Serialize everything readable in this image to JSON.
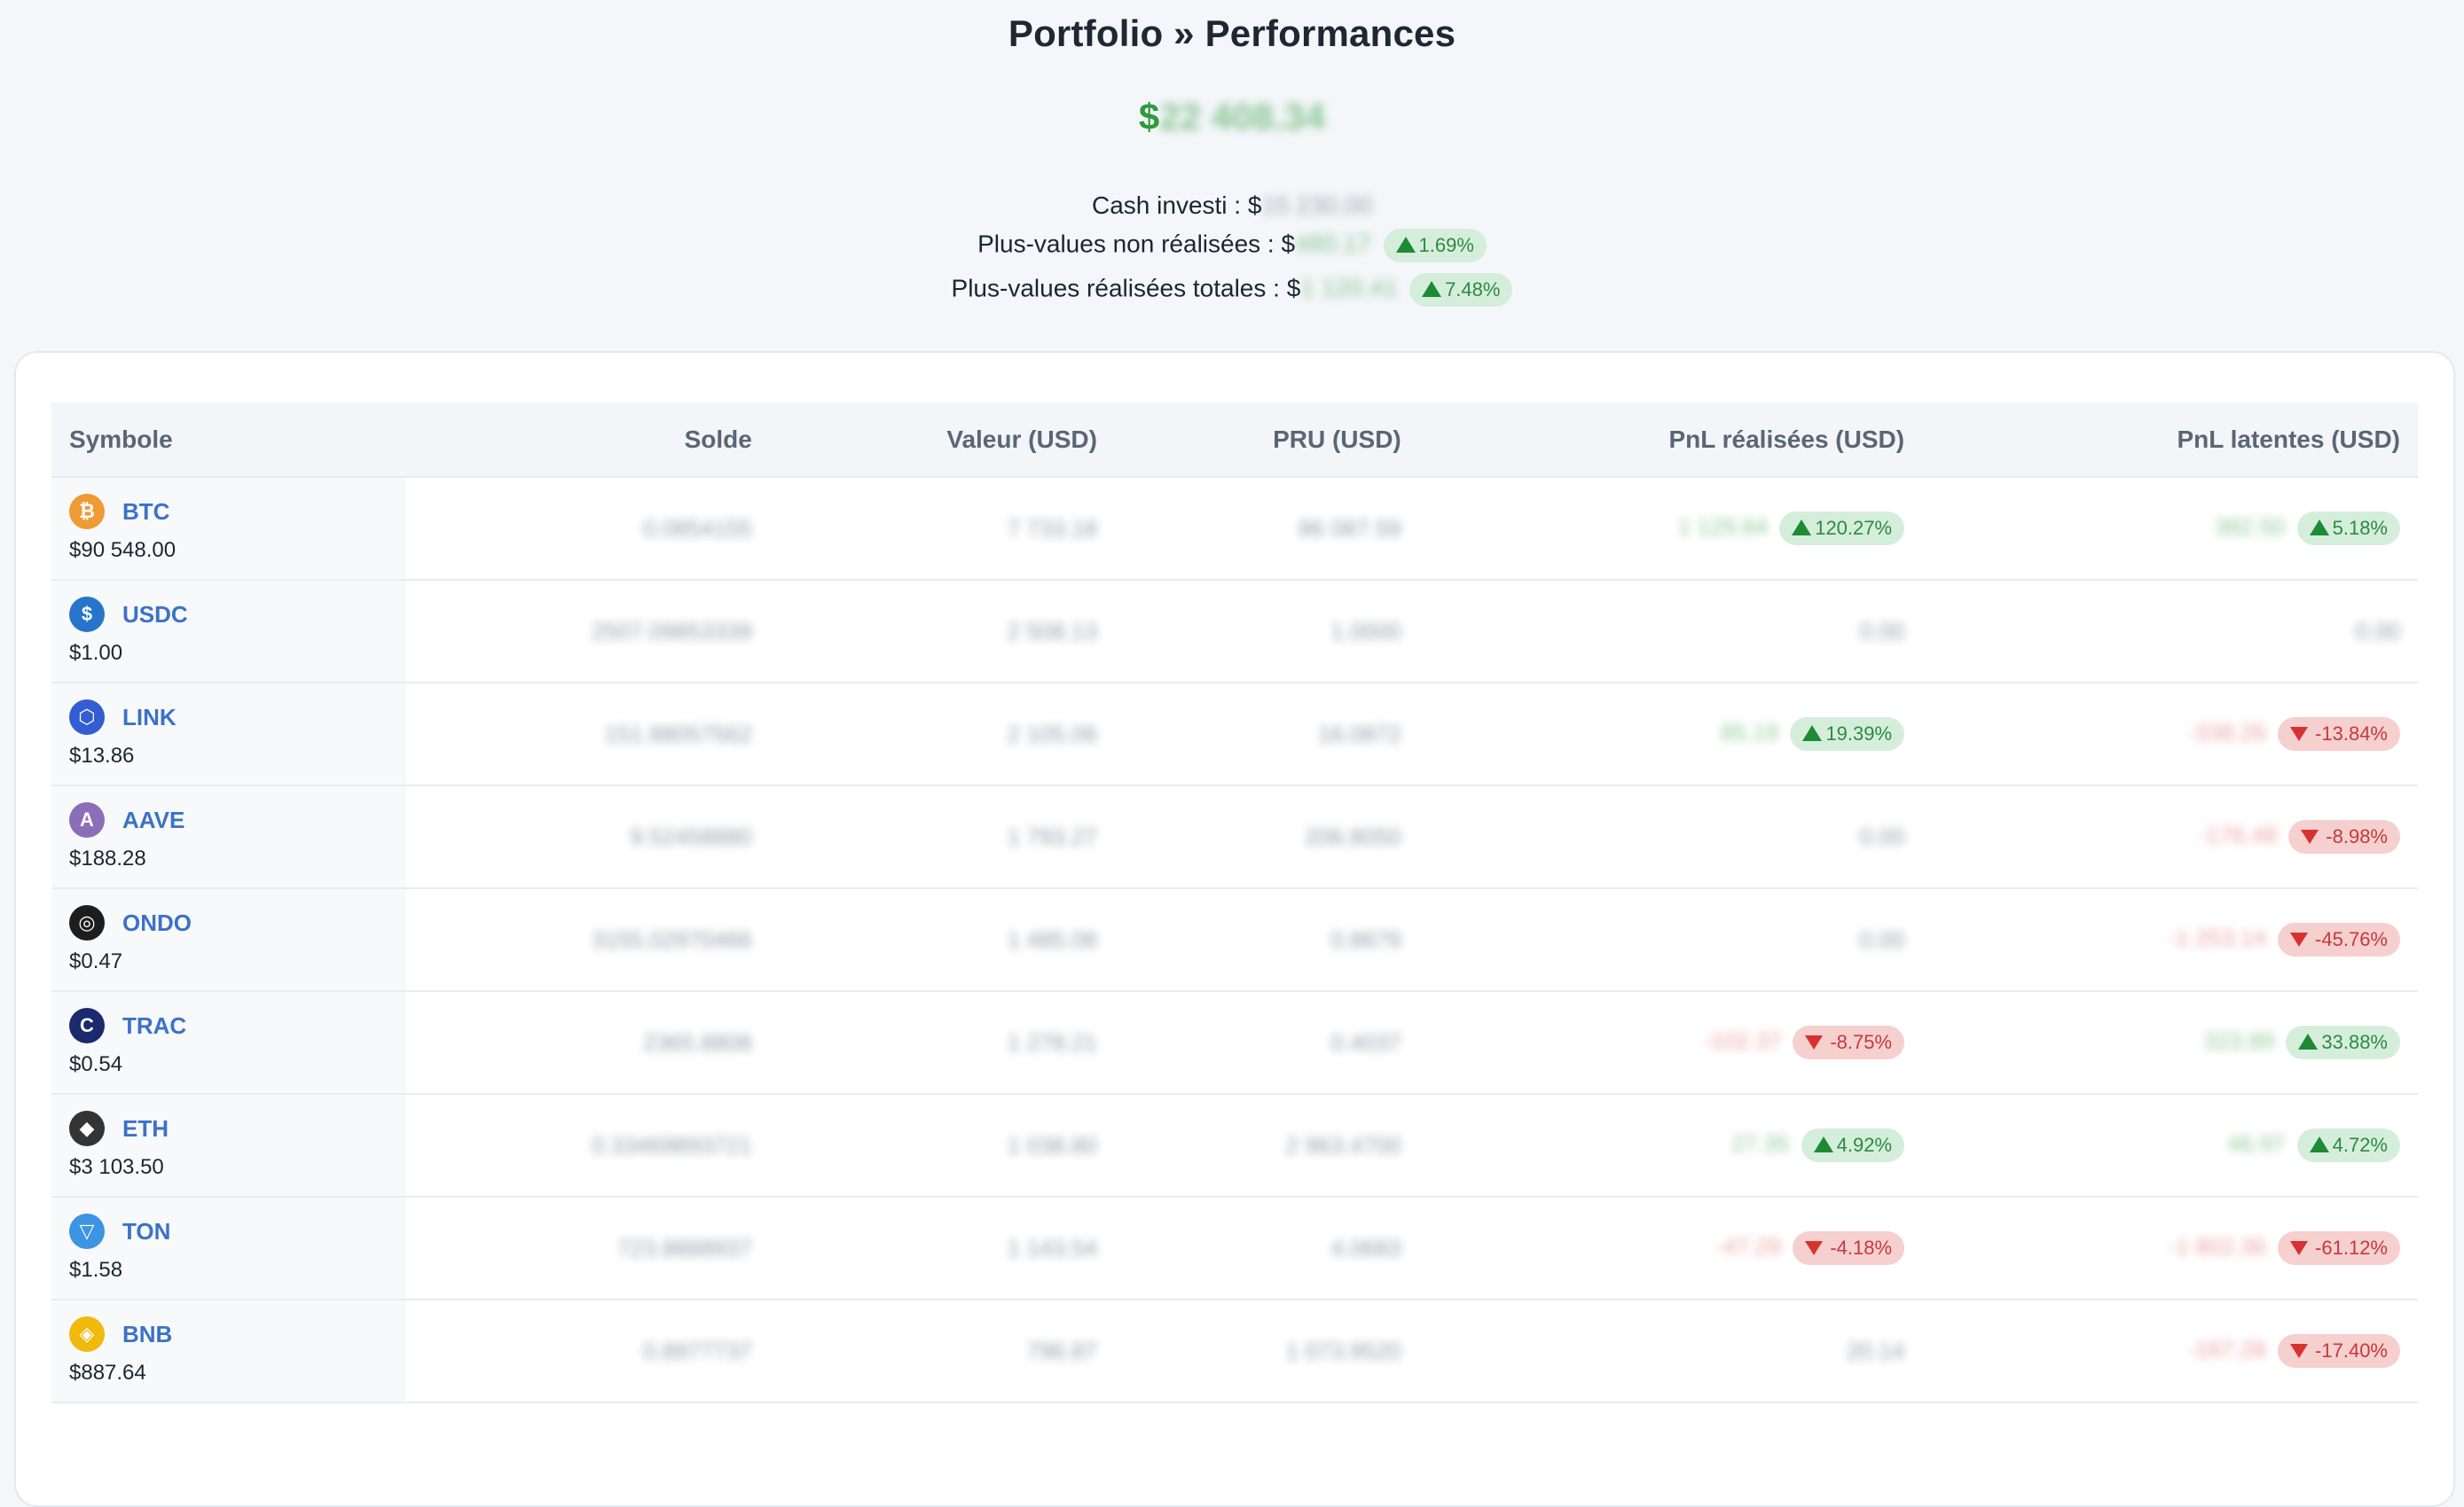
{
  "page": {
    "title": "Portfolio » Performances",
    "total_prefix": "$",
    "total_value": "22 408.34",
    "cash_label": "Cash investi : $",
    "cash_value": "15 230.00",
    "unrealized_label": "Plus-values non réalisées : $",
    "unrealized_value": "480.17",
    "unrealized_pct": "1.69%",
    "realized_label": "Plus-values réalisées totales : $",
    "realized_value": "1 120.41",
    "realized_pct": "7.48%"
  },
  "table": {
    "headers": [
      "Symbole",
      "Solde",
      "Valeur (USD)",
      "PRU (USD)",
      "PnL réalisées (USD)",
      "PnL latentes (USD)"
    ],
    "rows": [
      {
        "symbol": "BTC",
        "price": "$90 548.00",
        "icon": "bitcoin-icon",
        "color": "#f09a34",
        "solde": "0.0854155",
        "valeur": "7 733.18",
        "pru": "86 087.59",
        "pnl_r": "1 129.84",
        "pnl_r_pct": "120.27%",
        "pnl_r_dir": "up",
        "pnl_l": "382.50",
        "pnl_l_pct": "5.18%",
        "pnl_l_dir": "up"
      },
      {
        "symbol": "USDC",
        "price": "$1.00",
        "icon": "usdc-icon",
        "color": "#2775ca",
        "solde": "2507.09853339",
        "valeur": "2 508.13",
        "pru": "1.0000",
        "pnl_r": "0.00",
        "pnl_r_pct": "",
        "pnl_r_dir": "",
        "pnl_l": "0.00",
        "pnl_l_pct": "",
        "pnl_l_dir": ""
      },
      {
        "symbol": "LINK",
        "price": "$13.86",
        "icon": "chainlink-icon",
        "color": "#335dd2",
        "solde": "151.88057562",
        "valeur": "2 105.06",
        "pru": "16.0872",
        "pnl_r": "85.19",
        "pnl_r_pct": "19.39%",
        "pnl_r_dir": "up",
        "pnl_l": "-338.26",
        "pnl_l_pct": "-13.84%",
        "pnl_l_dir": "down"
      },
      {
        "symbol": "AAVE",
        "price": "$188.28",
        "icon": "aave-icon",
        "color": "#8a6fb8",
        "solde": "9.52458880",
        "valeur": "1 793.27",
        "pru": "206.8050",
        "pnl_r": "0.00",
        "pnl_r_pct": "",
        "pnl_r_dir": "",
        "pnl_l": "-176.48",
        "pnl_l_pct": "-8.98%",
        "pnl_l_dir": "down"
      },
      {
        "symbol": "ONDO",
        "price": "$0.47",
        "icon": "ondo-icon",
        "color": "#1d1d1d",
        "solde": "3155.02970466",
        "valeur": "1 485.08",
        "pru": "0.8679",
        "pnl_r": "0.00",
        "pnl_r_pct": "",
        "pnl_r_dir": "",
        "pnl_l": "-1 253.14",
        "pnl_l_pct": "-45.76%",
        "pnl_l_dir": "down"
      },
      {
        "symbol": "TRAC",
        "price": "$0.54",
        "icon": "trac-icon",
        "color": "#1a2a6c",
        "solde": "2365.8808",
        "valeur": "1 278.21",
        "pru": "0.4037",
        "pnl_r": "-102.37",
        "pnl_r_pct": "-8.75%",
        "pnl_r_dir": "down",
        "pnl_l": "323.89",
        "pnl_l_pct": "33.88%",
        "pnl_l_dir": "up"
      },
      {
        "symbol": "ETH",
        "price": "$3 103.50",
        "icon": "ethereum-icon",
        "color": "#343434",
        "solde": "0.33469893721",
        "valeur": "1 038.80",
        "pru": "2 963.4700",
        "pnl_r": "27.35",
        "pnl_r_pct": "4.92%",
        "pnl_r_dir": "up",
        "pnl_l": "46.97",
        "pnl_l_pct": "4.72%",
        "pnl_l_dir": "up"
      },
      {
        "symbol": "TON",
        "price": "$1.58",
        "icon": "toncoin-icon",
        "color": "#3c94e2",
        "solde": "723.8888937",
        "valeur": "1 143.54",
        "pru": "4.0683",
        "pnl_r": "-47.29",
        "pnl_r_pct": "-4.18%",
        "pnl_r_dir": "down",
        "pnl_l": "-1 802.36",
        "pnl_l_pct": "-61.12%",
        "pnl_l_dir": "down"
      },
      {
        "symbol": "BNB",
        "price": "$887.64",
        "icon": "bnb-icon",
        "color": "#f0b90b",
        "solde": "0.8977737",
        "valeur": "796.87",
        "pru": "1 073.9520",
        "pnl_r": "20.14",
        "pnl_r_pct": "",
        "pnl_r_dir": "",
        "pnl_l": "-167.28",
        "pnl_l_pct": "-17.40%",
        "pnl_l_dir": "down"
      }
    ]
  }
}
